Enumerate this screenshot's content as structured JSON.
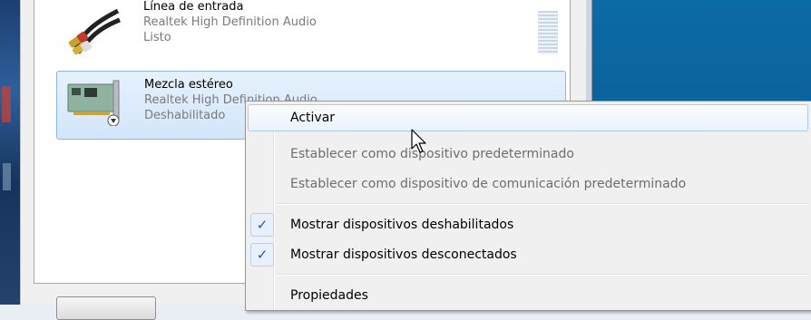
{
  "devices": [
    {
      "name": "Línea de entrada",
      "driver": "Realtek High Definition Audio",
      "status": "Listo",
      "icon": "rca-cable-icon"
    },
    {
      "name": "Mezcla estéreo",
      "driver": "Realtek High Definition Audio",
      "status": "Deshabilitado",
      "icon": "sound-card-icon"
    }
  ],
  "context_menu": {
    "items": [
      {
        "label": "Activar",
        "state": "hover"
      },
      {
        "label": "Establecer como dispositivo predeterminado",
        "state": "disabled"
      },
      {
        "label": "Establecer como dispositivo de comunicación predeterminado",
        "state": "disabled"
      },
      {
        "label": "Mostrar dispositivos deshabilitados",
        "checked": true
      },
      {
        "label": "Mostrar dispositivos desconectados",
        "checked": true
      },
      {
        "label": "Propiedades"
      }
    ],
    "check_glyph": "✓"
  },
  "colors": {
    "selection_border": "#8fb6e3",
    "check_color": "#1f56c1",
    "desktop_blue": "#0c6aa5"
  }
}
